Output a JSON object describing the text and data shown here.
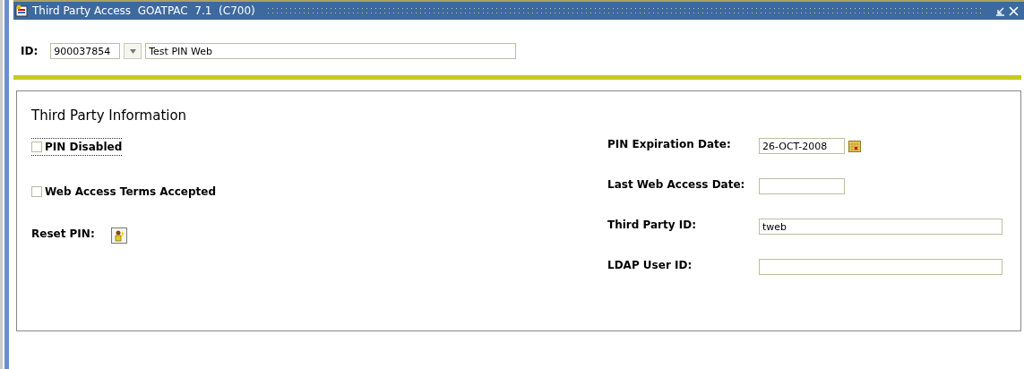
{
  "window": {
    "title": "Third Party Access  GOATPAC  7.1  (C700)"
  },
  "key_block": {
    "label": "ID:",
    "id_value": "900037854",
    "name_value": "Test PIN Web"
  },
  "section": {
    "title": "Third Party Information"
  },
  "left_items": [
    {
      "kind": "checkbox",
      "label": "PIN Disabled",
      "checked": false,
      "focused": true
    },
    {
      "kind": "checkbox",
      "label": "Web Access Terms Accepted",
      "checked": false,
      "focused": false
    },
    {
      "kind": "button",
      "label": "Reset PIN:"
    }
  ],
  "right_fields": [
    {
      "kind": "date_picker",
      "label": "PIN Expiration Date:",
      "value": "26-OCT-2008"
    },
    {
      "kind": "date",
      "label": "Last Web Access Date:"
    },
    {
      "kind": "text",
      "label": "Third Party ID:",
      "value": "tweb"
    },
    {
      "kind": "text",
      "label": "LDAP User ID:"
    }
  ]
}
